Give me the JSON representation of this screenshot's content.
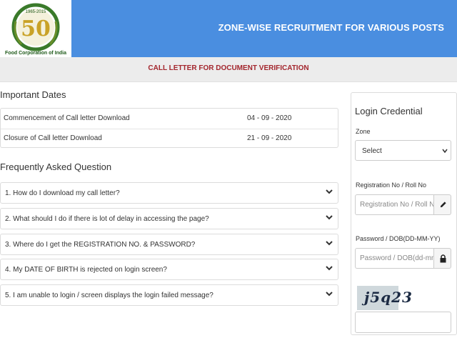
{
  "header": {
    "title": "ZONE-WISE RECRUITMENT FOR VARIOUS POSTS",
    "logo": {
      "number": "50",
      "org_name": "Food Corporation of India",
      "years": "1965-2015",
      "colors": {
        "ring": "#3a7a2a",
        "number": "#c9a227",
        "text": "#1f5a1a"
      }
    },
    "bg_color": "#4a8ee0"
  },
  "subbar": {
    "title": "CALL LETTER FOR DOCUMENT VERIFICATION",
    "color": "#a3262d"
  },
  "important_dates": {
    "title": "Important Dates",
    "rows": [
      {
        "label": "Commencement of Call letter Download",
        "value": "04 - 09 - 2020"
      },
      {
        "label": "Closure of Call letter Download",
        "value": "21 - 09 - 2020"
      }
    ]
  },
  "faq": {
    "title": "Frequently Asked Question",
    "items": [
      {
        "question": "1. How do I download my call letter?"
      },
      {
        "question": "2. What should I do if there is lot of delay in accessing the page?"
      },
      {
        "question": "3. Where do I get the REGISTRATION NO. & PASSWORD?"
      },
      {
        "question": "4. My DATE OF BIRTH is rejected on login screen?"
      },
      {
        "question": "5. I am unable to login / screen displays the login failed message?"
      }
    ],
    "icon": "chevron-down-icon"
  },
  "login": {
    "title": "Login Credential",
    "zone": {
      "label": "Zone",
      "selected": "Select"
    },
    "registration": {
      "label": "Registration No / Roll No",
      "placeholder": "Registration No / Roll No",
      "icon": "pencil-icon"
    },
    "password": {
      "label": "Password / DOB(DD-MM-YY)",
      "placeholder": "Password / DOB(dd-mm-yy)",
      "icon": "lock-icon"
    },
    "captcha": {
      "text": "j5q23"
    }
  }
}
